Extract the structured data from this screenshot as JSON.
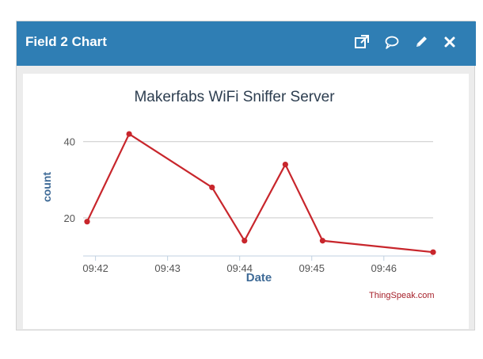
{
  "widget": {
    "title": "Field 2 Chart",
    "icons": {
      "open": "external-link-icon",
      "comment": "comment-icon",
      "edit": "pencil-icon",
      "close": "close-icon"
    },
    "header_color": "#2f7eb4"
  },
  "credit": {
    "text": "ThingSpeak.com"
  },
  "chart_data": {
    "type": "line",
    "title": "Makerfabs WiFi Sniffer Server",
    "xlabel": "Date",
    "ylabel": "count",
    "x_tick_labels": [
      "09:42",
      "09:43",
      "09:44",
      "09:45",
      "09:46"
    ],
    "y_tick_labels": [
      "20",
      "40"
    ],
    "series": [
      {
        "color": "#c8262c",
        "points": [
          {
            "x": "09:41:53",
            "y": 19
          },
          {
            "x": "09:42:28",
            "y": 42
          },
          {
            "x": "09:43:37",
            "y": 28
          },
          {
            "x": "09:44:04",
            "y": 14
          },
          {
            "x": "09:44:38",
            "y": 34
          },
          {
            "x": "09:45:09",
            "y": 14
          },
          {
            "x": "09:46:41",
            "y": 11
          }
        ]
      }
    ],
    "grid": "horizontal"
  }
}
